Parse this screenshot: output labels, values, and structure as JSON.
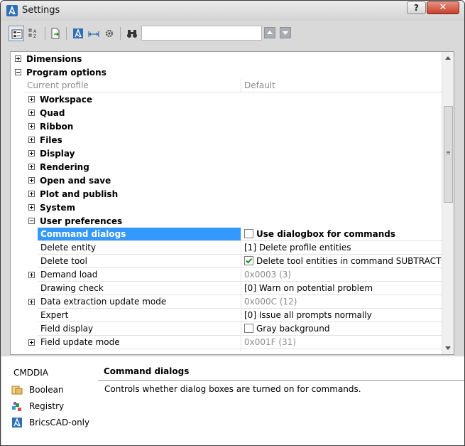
{
  "window": {
    "title": "Settings"
  },
  "titlebar": {
    "help_label": "?",
    "close_label": "✕"
  },
  "toolbar": {
    "search_value": ""
  },
  "tree": {
    "categories_top": [
      {
        "label": "Dimensions",
        "expanded": false
      },
      {
        "label": "Program options",
        "expanded": true
      }
    ],
    "profile_row": {
      "label": "Current profile",
      "value": "Default"
    },
    "program_children": [
      {
        "label": "Workspace"
      },
      {
        "label": "Quad"
      },
      {
        "label": "Ribbon"
      },
      {
        "label": "Files"
      },
      {
        "label": "Display"
      },
      {
        "label": "Rendering"
      },
      {
        "label": "Open and save"
      },
      {
        "label": "Plot and publish"
      },
      {
        "label": "System"
      }
    ],
    "user_preferences": {
      "label": "User preferences",
      "expanded": true
    },
    "settings": [
      {
        "label": "Command dialogs",
        "value": "Use dialogbox for commands",
        "checkbox": true,
        "checked": false,
        "selected": true,
        "expandable": false,
        "gray": false
      },
      {
        "label": "Delete entity",
        "value": "[1] Delete profile entities",
        "checkbox": false,
        "selected": false,
        "expandable": false,
        "gray": false
      },
      {
        "label": "Delete tool",
        "value": "Delete tool entities in command SUBTRACT",
        "checkbox": true,
        "checked": true,
        "selected": false,
        "expandable": false,
        "gray": false
      },
      {
        "label": "Demand load",
        "value": "0x0003 (3)",
        "checkbox": false,
        "selected": false,
        "expandable": true,
        "gray": true
      },
      {
        "label": "Drawing check",
        "value": "[0] Warn on potential problem",
        "checkbox": false,
        "selected": false,
        "expandable": false,
        "gray": false
      },
      {
        "label": "Data extraction update mode",
        "value": "0x000C (12)",
        "checkbox": false,
        "selected": false,
        "expandable": true,
        "gray": true
      },
      {
        "label": "Expert",
        "value": "[0] Issue all prompts normally",
        "checkbox": false,
        "selected": false,
        "expandable": false,
        "gray": false
      },
      {
        "label": "Field display",
        "value": "Gray background",
        "checkbox": true,
        "checked": false,
        "selected": false,
        "expandable": false,
        "gray": false
      },
      {
        "label": "Field update mode",
        "value": "0x001F (31)",
        "checkbox": false,
        "selected": false,
        "expandable": true,
        "gray": true
      }
    ]
  },
  "info": {
    "variable_name": "CMDDIA",
    "legend": [
      {
        "icon": "boolean-icon",
        "label": "Boolean"
      },
      {
        "icon": "registry-icon",
        "label": "Registry"
      },
      {
        "icon": "bricscad-icon",
        "label": "BricsCAD-only"
      }
    ],
    "description_title": "Command dialogs",
    "description_text": "Controls whether dialog boxes are turned on for commands."
  },
  "colors": {
    "selection": "#3399ff",
    "close_button": "#c6412b"
  }
}
